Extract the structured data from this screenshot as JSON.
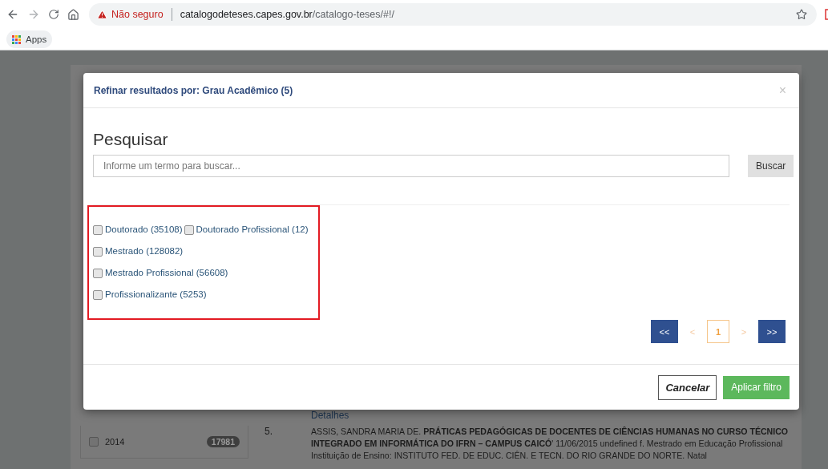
{
  "browser": {
    "security_label": "Não seguro",
    "url_host": "catalogodeteses.capes.gov.br",
    "url_path": "/catalogo-teses/#!/",
    "bookmarks": [
      "Apps"
    ]
  },
  "background": {
    "sidebar_item": {
      "label": "2014",
      "count": "17981",
      "checked": false
    },
    "result": {
      "details_link": "Detalhes",
      "number": "5.",
      "text": "ASSIS, SANDRA MARIA DE. **PRÁTICAS PEDAGÓGICAS DE DOCENTES DE CIÊNCIAS HUMANAS NO CURSO TÉCNICO INTEGRADO EM INFORMÁTICA DO IFRN – CAMPUS CAICÓ**' 11/06/2015 undefined f. Mestrado em Educação Profissional Instituição de Ensino: INSTITUTO FED. DE EDUC. CIÊN. E TECN. DO RIO GRANDE DO NORTE. Natal"
    }
  },
  "modal": {
    "title": "Refinar resultados por: Grau Acadêmico (5)",
    "close": "×",
    "search_heading": "Pesquisar",
    "search": {
      "placeholder": "Informe um termo para buscar..."
    },
    "search_button": "Buscar",
    "options": [
      [
        {
          "label": "Doutorado (35108)",
          "checked": false
        },
        {
          "label": "Doutorado Profissional (12)",
          "checked": false
        }
      ],
      [
        {
          "label": "Mestrado (128082)",
          "checked": false
        }
      ],
      [
        {
          "label": "Mestrado Profissional (56608)",
          "checked": false
        }
      ],
      [
        {
          "label": "Profissionalizante (5253)",
          "checked": false
        }
      ]
    ],
    "pagination": [
      {
        "kind": "first",
        "label": "<<",
        "disabled": false
      },
      {
        "kind": "prev",
        "label": "<",
        "disabled": true
      },
      {
        "kind": "page",
        "label": "1",
        "selected": true
      },
      {
        "kind": "next",
        "label": ">",
        "disabled": true
      },
      {
        "kind": "last",
        "label": ">>",
        "disabled": false
      }
    ],
    "buttons": {
      "cancel": "Cancelar",
      "apply": "Aplicar filtro"
    }
  }
}
